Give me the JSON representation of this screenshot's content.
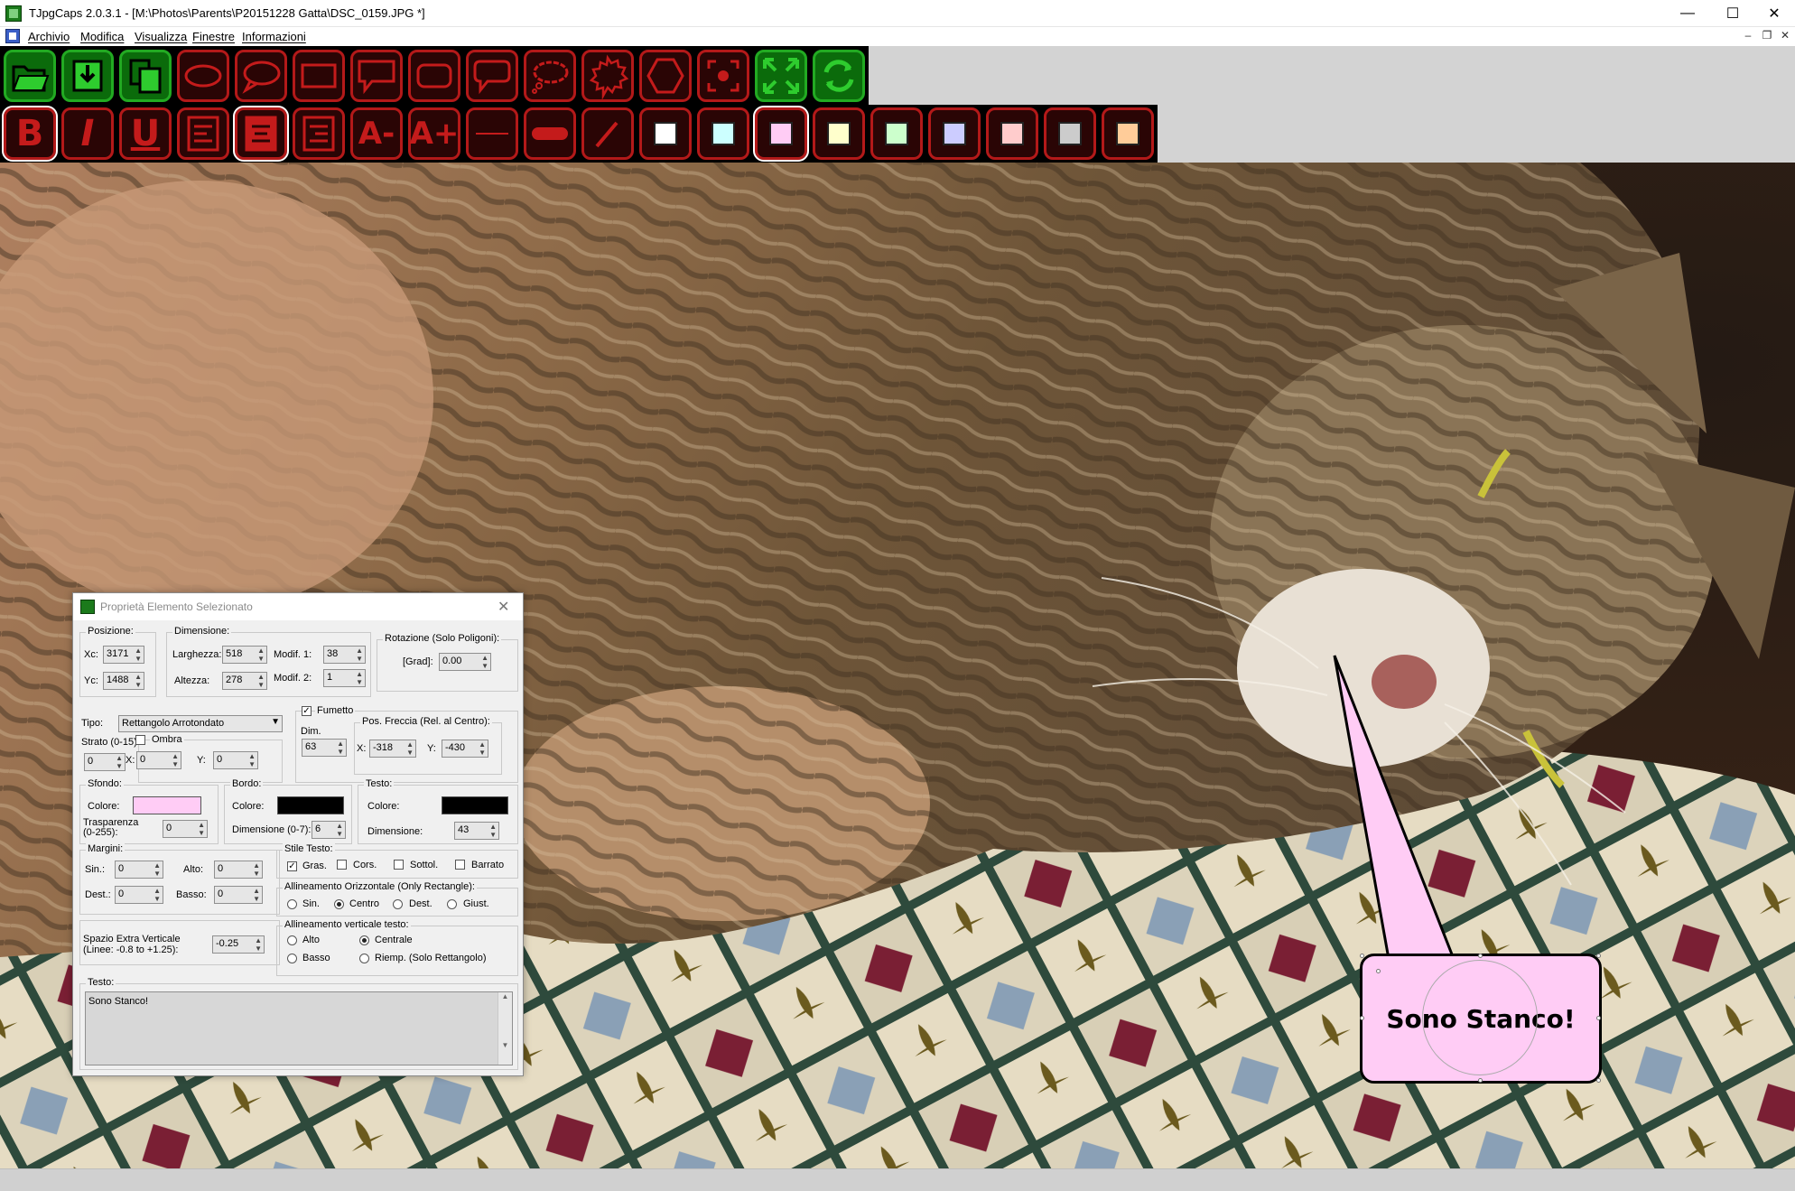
{
  "window": {
    "title": "TJpgCaps 2.0.3.1 - [M:\\Photos\\Parents\\P20151228 Gatta\\DSC_0159.JPG *]"
  },
  "menu": {
    "items": [
      "Archivio",
      "Modifica",
      "Visualizza",
      "Finestre",
      "Informazioni"
    ]
  },
  "toolbar1": [
    "open-folder-icon",
    "save-icon",
    "copy-icon",
    "ellipse-shape-icon",
    "ellipse-callout-icon",
    "rectangle-shape-icon",
    "rectangle-callout-icon",
    "rounded-rectangle-icon",
    "rounded-callout-icon",
    "cloud-callout-icon",
    "spiky-callout-icon",
    "hexagon-icon",
    "focus-target-icon",
    "fit-screen-icon",
    "refresh-icon"
  ],
  "toolbar2": {
    "bold": "B",
    "italic": "I",
    "underline": "U",
    "font_smaller": "A-",
    "font_larger": "A+",
    "swatches": [
      "#ffffff",
      "#ccffff",
      "#ffccf5",
      "#ffffcc",
      "#ccffcc",
      "#ccccff",
      "#ffcccc",
      "#cccccc",
      "#ffcc99"
    ]
  },
  "bubble": {
    "text": "Sono Stanco!",
    "fill": "#ffccf5"
  },
  "dialog": {
    "title": "Proprietà Elemento Selezionato",
    "posizione": {
      "legend": "Posizione:",
      "xc_label": "Xc:",
      "xc": "3171",
      "yc_label": "Yc:",
      "yc": "1488"
    },
    "dimensione": {
      "legend": "Dimensione:",
      "larghezza_label": "Larghezza:",
      "larghezza": "518",
      "altezza_label": "Altezza:",
      "altezza": "278",
      "modif1_label": "Modif. 1:",
      "modif1": "38",
      "modif2_label": "Modif. 2:",
      "modif2": "1"
    },
    "rotazione": {
      "legend": "Rotazione (Solo Poligoni):",
      "grad_label": "[Grad]:",
      "grad": "0.00"
    },
    "tipo": {
      "label": "Tipo:",
      "value": "Rettangolo Arrotondato"
    },
    "strato": {
      "label": "Strato (0-15):",
      "value": "0"
    },
    "ombra": {
      "label": "Ombra",
      "x_label": "X:",
      "x": "0",
      "y_label": "Y:",
      "y": "0"
    },
    "fumetto": {
      "label": "Fumetto",
      "dim_label": "Dim.",
      "dim": "63"
    },
    "freccia": {
      "legend": "Pos. Freccia (Rel. al Centro):",
      "x_label": "X:",
      "x": "-318",
      "y_label": "Y:",
      "y": "-430"
    },
    "sfondo": {
      "legend": "Sfondo:",
      "colore_label": "Colore:",
      "trasparenza_label": "Trasparenza\n(0-255):",
      "trasparenza": "0",
      "color": "#ffccf5"
    },
    "bordo": {
      "legend": "Bordo:",
      "colore_label": "Colore:",
      "dimensione_label": "Dimensione (0-7):",
      "dimensione": "6",
      "color": "#000000"
    },
    "testo_style": {
      "legend": "Testo:",
      "colore_label": "Colore:",
      "dimensione_label": "Dimensione:",
      "dimensione": "43",
      "color": "#000000"
    },
    "margini": {
      "legend": "Margini:",
      "sin_label": "Sin.:",
      "sin": "0",
      "alto_label": "Alto:",
      "alto": "0",
      "dest_label": "Dest.:",
      "dest": "0",
      "basso_label": "Basso:",
      "basso": "0"
    },
    "stile": {
      "legend": "Stile Testo:",
      "gras": "Gras.",
      "cors": "Cors.",
      "sottol": "Sottol.",
      "barrato": "Barrato"
    },
    "allin_orizz": {
      "legend": "Allineamento Orizzontale (Only Rectangle):",
      "sin": "Sin.",
      "centro": "Centro",
      "dest": "Dest.",
      "giust": "Giust."
    },
    "spazio": {
      "label1": "Spazio Extra Verticale",
      "label2": "(Linee: -0.8 to +1.25):",
      "value": "-0.25"
    },
    "allin_vert": {
      "legend": "Allineamento verticale testo:",
      "alto": "Alto",
      "centrale": "Centrale",
      "basso": "Basso",
      "riemp": "Riemp. (Solo Rettangolo)"
    },
    "testo": {
      "legend": "Testo:",
      "value": "Sono Stanco!"
    }
  }
}
